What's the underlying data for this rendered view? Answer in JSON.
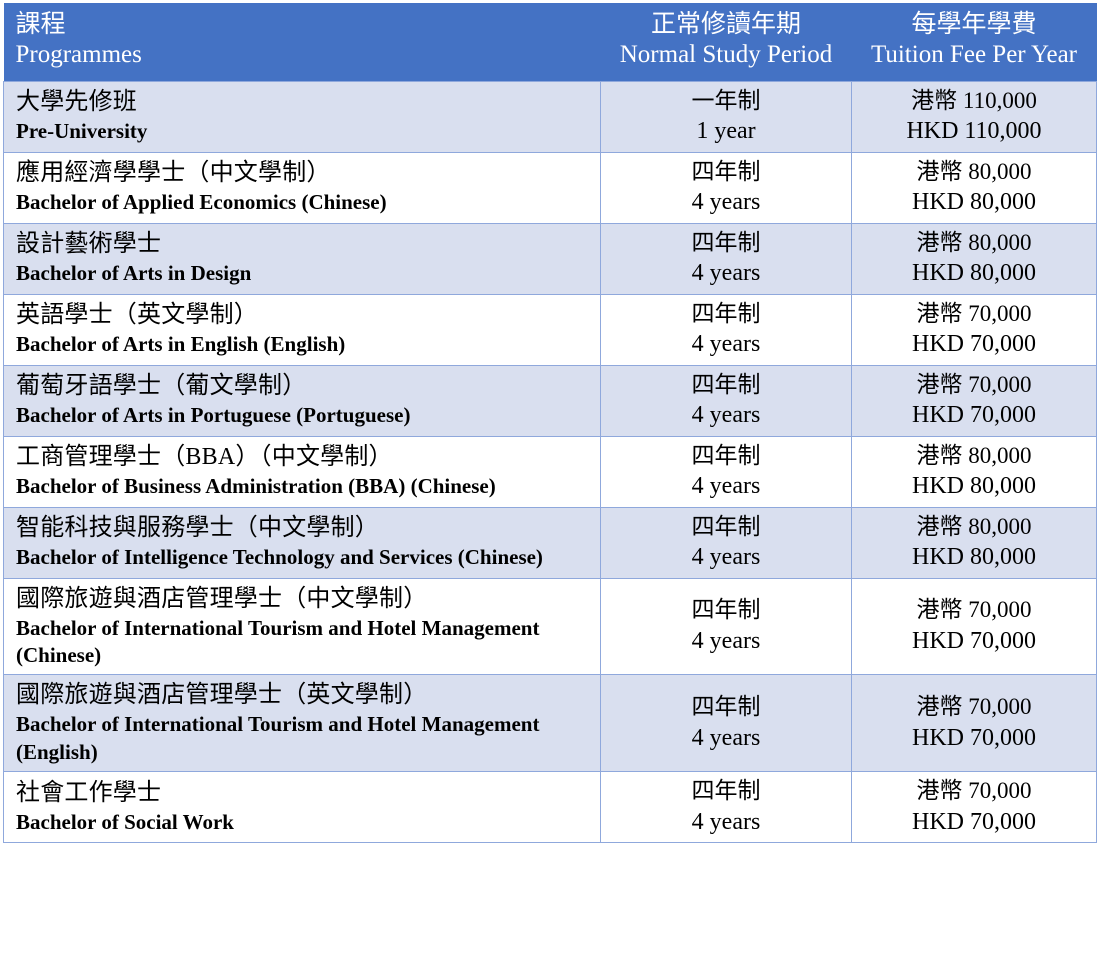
{
  "table": {
    "accent_color": "#4472C4",
    "row_shade_color": "#D9DFEF",
    "border_color": "#8FA8DC",
    "header": {
      "programmes_cn": "課程",
      "programmes_en": "Programmes",
      "period_cn": "正常修讀年期",
      "period_en": "Normal Study Period",
      "fee_cn": "每學年學費",
      "fee_en": "Tuition Fee Per Year"
    },
    "rows": [
      {
        "shaded": true,
        "programme_cn": "大學先修班",
        "programme_en": "Pre-University",
        "period_cn": "一年制",
        "period_en": "1 year",
        "fee_cn": "港幣 110,000",
        "fee_en": "HKD 110,000"
      },
      {
        "shaded": false,
        "programme_cn": "應用經濟學學士（中文學制）",
        "programme_en": "Bachelor of Applied Economics (Chinese)",
        "period_cn": "四年制",
        "period_en": "4 years",
        "fee_cn": "港幣 80,000",
        "fee_en": "HKD 80,000"
      },
      {
        "shaded": true,
        "programme_cn": "設計藝術學士",
        "programme_en": "Bachelor of Arts in Design",
        "period_cn": "四年制",
        "period_en": "4 years",
        "fee_cn": "港幣 80,000",
        "fee_en": "HKD 80,000"
      },
      {
        "shaded": false,
        "programme_cn": "英語學士（英文學制）",
        "programme_en": "Bachelor of Arts in English (English)",
        "period_cn": "四年制",
        "period_en": "4 years",
        "fee_cn": "港幣 70,000",
        "fee_en": "HKD 70,000"
      },
      {
        "shaded": true,
        "programme_cn": "葡萄牙語學士（葡文學制）",
        "programme_en": "Bachelor of Arts in Portuguese (Portuguese)",
        "period_cn": "四年制",
        "period_en": "4 years",
        "fee_cn": "港幣 70,000",
        "fee_en": "HKD 70,000"
      },
      {
        "shaded": false,
        "programme_cn": "工商管理學士（BBA）（中文學制）",
        "programme_en": "Bachelor of Business Administration (BBA) (Chinese)",
        "period_cn": "四年制",
        "period_en": "4 years",
        "fee_cn": "港幣 80,000",
        "fee_en": "HKD 80,000"
      },
      {
        "shaded": true,
        "programme_cn": "智能科技與服務學士（中文學制）",
        "programme_en": "Bachelor of Intelligence Technology and Services (Chinese)",
        "period_cn": "四年制",
        "period_en": "4 years",
        "fee_cn": "港幣 80,000",
        "fee_en": "HKD 80,000"
      },
      {
        "shaded": false,
        "programme_cn": "國際旅遊與酒店管理學士（中文學制）",
        "programme_en": "Bachelor of International Tourism and Hotel Management (Chinese)",
        "period_cn": "四年制",
        "period_en": "4 years",
        "fee_cn": "港幣 70,000",
        "fee_en": "HKD 70,000"
      },
      {
        "shaded": true,
        "programme_cn": "國際旅遊與酒店管理學士（英文學制）",
        "programme_en": "Bachelor of International Tourism and Hotel Management (English)",
        "period_cn": "四年制",
        "period_en": "4 years",
        "fee_cn": "港幣 70,000",
        "fee_en": "HKD 70,000"
      },
      {
        "shaded": false,
        "programme_cn": "社會工作學士",
        "programme_en": "Bachelor of Social Work",
        "period_cn": "四年制",
        "period_en": "4 years",
        "fee_cn": "港幣 70,000",
        "fee_en": "HKD 70,000"
      }
    ]
  }
}
